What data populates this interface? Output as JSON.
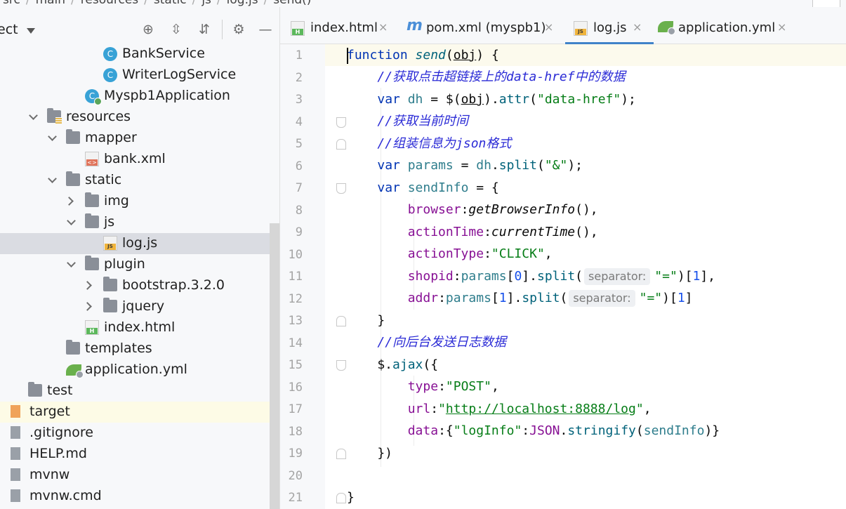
{
  "breadcrumb": [
    "src",
    "main",
    "resources",
    "static",
    "js",
    "log.js",
    "send()"
  ],
  "sidebar": {
    "title": "ect",
    "tree": [
      {
        "label": "BankService",
        "icon": "class-icon",
        "indent": 120,
        "arrow": ""
      },
      {
        "label": "WriterLogService",
        "icon": "class-icon",
        "indent": 120,
        "arrow": ""
      },
      {
        "label": "Myspb1Application",
        "icon": "app-icon",
        "indent": 94,
        "arrow": ""
      },
      {
        "label": "resources",
        "icon": "res-folder-icon",
        "indent": 40,
        "arrow": "down"
      },
      {
        "label": "mapper",
        "icon": "folder-icon",
        "indent": 67,
        "arrow": "down"
      },
      {
        "label": "bank.xml",
        "icon": "xml-file-icon",
        "indent": 94,
        "arrow": ""
      },
      {
        "label": "static",
        "icon": "folder-icon",
        "indent": 67,
        "arrow": "down"
      },
      {
        "label": "img",
        "icon": "folder-icon",
        "indent": 94,
        "arrow": "right"
      },
      {
        "label": "js",
        "icon": "folder-icon",
        "indent": 94,
        "arrow": "down"
      },
      {
        "label": "log.js",
        "icon": "js-file-icon",
        "indent": 120,
        "arrow": "",
        "selected": true
      },
      {
        "label": "plugin",
        "icon": "folder-icon",
        "indent": 94,
        "arrow": "down"
      },
      {
        "label": "bootstrap.3.2.0",
        "icon": "folder-icon",
        "indent": 120,
        "arrow": "right"
      },
      {
        "label": "jquery",
        "icon": "folder-icon",
        "indent": 120,
        "arrow": "right"
      },
      {
        "label": "index.html",
        "icon": "html-file-icon",
        "indent": 94,
        "arrow": ""
      },
      {
        "label": "templates",
        "icon": "folder-icon",
        "indent": 67,
        "arrow": ""
      },
      {
        "label": "application.yml",
        "icon": "yml-file-icon",
        "indent": 67,
        "arrow": ""
      },
      {
        "label": "test",
        "icon": "folder-icon",
        "indent": 13,
        "arrow": ""
      },
      {
        "label": "target",
        "icon": "orange-folder-icon",
        "indent": -12,
        "arrow": "",
        "ignored": true
      },
      {
        "label": ".gitignore",
        "icon": "file-icon",
        "indent": -12,
        "arrow": ""
      },
      {
        "label": "HELP.md",
        "icon": "file-icon",
        "indent": -12,
        "arrow": ""
      },
      {
        "label": "mvnw",
        "icon": "file-icon",
        "indent": -12,
        "arrow": ""
      },
      {
        "label": "mvnw.cmd",
        "icon": "file-icon",
        "indent": -12,
        "arrow": ""
      }
    ]
  },
  "tabs": [
    {
      "label": "index.html",
      "icon": "html-file-icon",
      "close": "×"
    },
    {
      "label": "pom.xml (myspb1)",
      "icon": "maven-icon",
      "close": "×"
    },
    {
      "label": "log.js",
      "icon": "js-file-icon",
      "close": "×",
      "active": true
    },
    {
      "label": "application.yml",
      "icon": "yml-file-icon",
      "close": "×"
    }
  ],
  "editor": {
    "line_numbers": [
      "1",
      "2",
      "3",
      "4",
      "5",
      "6",
      "7",
      "8",
      "9",
      "10",
      "11",
      "12",
      "13",
      "14",
      "15",
      "16",
      "17",
      "18",
      "19",
      "20",
      "21"
    ],
    "hint_separator": "separator:",
    "code": {
      "l1_kw": "function",
      "l1_fn": "send",
      "l1_param": "obj",
      "l2_comment": "//获取点击超链接上的data-href中的数据",
      "l3_kw": "var",
      "l3_var": "dh",
      "l3_obj": "obj",
      "l3_method": "attr",
      "l3_str": "\"data-href\"",
      "l4_comment": "//获取当前时间",
      "l5_comment": "//组装信息为json格式",
      "l6_kw": "var",
      "l6_var": "params",
      "l6_dh": "dh",
      "l6_method": "split",
      "l6_str": "\"&\"",
      "l7_kw": "var",
      "l7_var": "sendInfo",
      "l8_prop": "browser",
      "l8_call": "getBrowserInfo",
      "l9_prop": "actionTime",
      "l9_call": "currentTime",
      "l10_prop": "actionType",
      "l10_str": "\"CLICK\"",
      "l11_prop": "shopid",
      "l11_params": "params",
      "l11_idx": "0",
      "l11_method": "split",
      "l11_str": "\"=\"",
      "l11_idx2": "1",
      "l12_prop": "addr",
      "l12_params": "params",
      "l12_idx": "1",
      "l12_method": "split",
      "l12_str": "\"=\"",
      "l12_idx2": "1",
      "l14_comment": "//向后台发送日志数据",
      "l15_method": "ajax",
      "l16_prop": "type",
      "l16_str": "\"POST\"",
      "l17_prop": "url",
      "l17_url": "http://localhost:8888/log",
      "l18_prop": "data",
      "l18_key": "\"logInfo\"",
      "l18_json": "JSON",
      "l18_method": "stringify",
      "l18_arg": "sendInfo"
    }
  }
}
